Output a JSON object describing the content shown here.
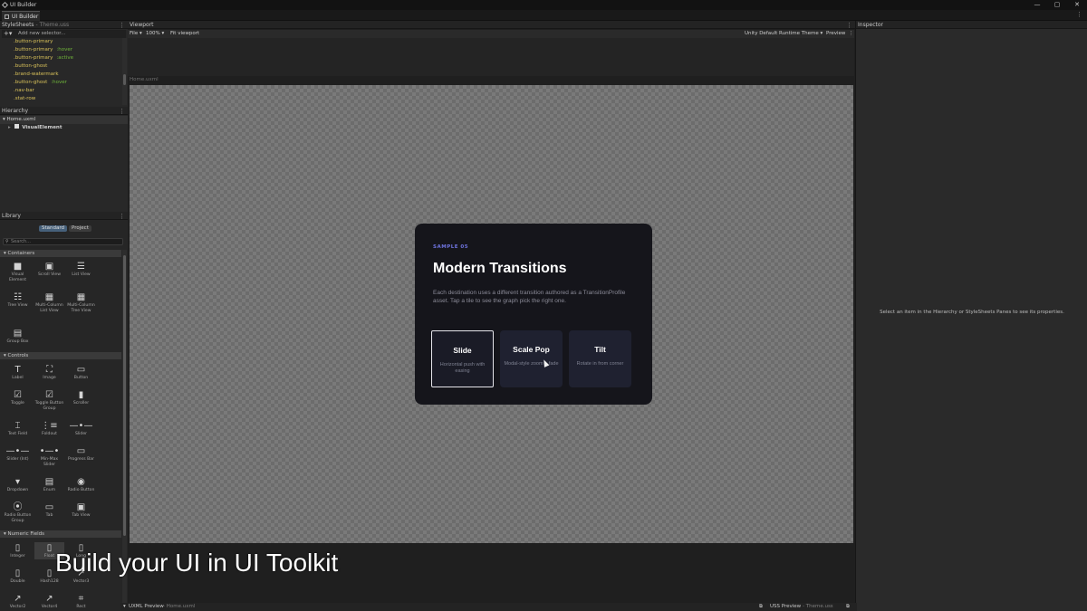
{
  "window": {
    "title": "UI Builder",
    "minimize": "—",
    "maximize": "▢",
    "close": "✕"
  },
  "tab": {
    "label": "UI Builder"
  },
  "stylesheets": {
    "header": "StyleSheets",
    "file": " - Theme.uss",
    "add_label": "Add new selector...",
    "selectors": [
      {
        "name": ".button-primary",
        "pseudo": ""
      },
      {
        "name": ".button-primary",
        "pseudo": ":hover"
      },
      {
        "name": ".button-primary",
        "pseudo": ":active"
      },
      {
        "name": ".button-ghost",
        "pseudo": ""
      },
      {
        "name": ".brand-watermark",
        "pseudo": ""
      },
      {
        "name": ".button-ghost",
        "pseudo": ":hover"
      },
      {
        "name": ".nav-bar",
        "pseudo": ""
      },
      {
        "name": ".stat-row",
        "pseudo": ""
      }
    ]
  },
  "hierarchy": {
    "header": "Hierarchy",
    "root": "Home.uxml",
    "child": "VisualElement"
  },
  "library": {
    "header": "Library",
    "tab_standard": "Standard",
    "tab_project": "Project",
    "search_placeholder": "Search...",
    "categories": [
      "Containers",
      "Controls",
      "Numeric Fields"
    ],
    "containers": [
      "Visual Element",
      "Scroll View",
      "List View",
      "Tree View",
      "Multi-Column List View",
      "Multi-Column Tree View",
      "Group Box"
    ],
    "controls": [
      "Label",
      "Image",
      "Button",
      "Toggle",
      "Toggle Button Group",
      "Scroller",
      "Text Field",
      "Foldout",
      "Slider",
      "Slider (Int)",
      "Min-Max Slider",
      "Progress Bar",
      "Dropdown",
      "Enum",
      "Radio Button",
      "Radio Button Group",
      "Tab",
      "Tab View"
    ],
    "numeric": [
      "Integer",
      "Float",
      "Long",
      "Double",
      "Hash128",
      "Vector3",
      "Vector2",
      "Vector4",
      "Rect"
    ]
  },
  "viewport": {
    "header": "Viewport",
    "file_menu": "File ▾",
    "zoom": "100% ▾",
    "fit": "Fit viewport",
    "theme": "Unity Default Runtime Theme ▾",
    "preview": "Preview",
    "canvas_label": "Home.uxml"
  },
  "card": {
    "eyebrow": "SAMPLE 05",
    "title": "Modern Transitions",
    "description": "Each destination uses a different transition authored as a TransitionProfile asset. Tap a tile to see the graph pick the right one.",
    "tiles": [
      {
        "name": "Slide",
        "desc": "Horizontal push with easing",
        "active": true
      },
      {
        "name": "Scale Pop",
        "desc": "Modal-style zoom + fade",
        "active": false
      },
      {
        "name": "Tilt",
        "desc": "Rotate in from corner",
        "active": false
      }
    ]
  },
  "inspector": {
    "header": "Inspector",
    "message": "Select an item in the Hierarchy or StyleSheets Panes to see its properties."
  },
  "bottom": {
    "uxml_preview": "UXML Preview",
    "uxml_file": " - Home.uxml",
    "uss_preview": "USS Preview",
    "uss_file": " - Theme.uss"
  },
  "caption": "Build your UI in UI Toolkit",
  "colors": {
    "accent": "#6f74e0",
    "card_bg": "#15151b",
    "selector": "#d8c15a",
    "pseudo": "#6fb33a"
  }
}
